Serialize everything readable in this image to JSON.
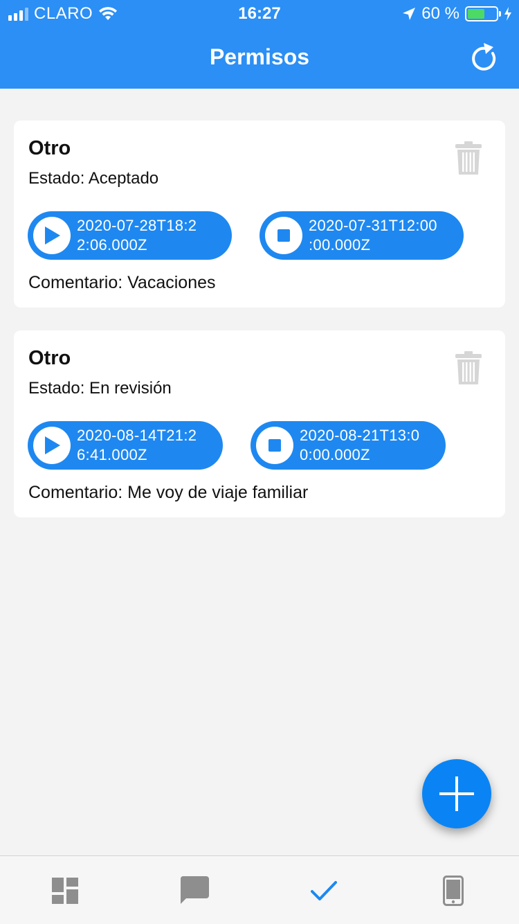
{
  "status_bar": {
    "carrier": "CLARO",
    "time": "16:27",
    "battery_label": "60 %",
    "battery_level": 0.6
  },
  "header": {
    "title": "Permisos",
    "refresh_icon": "refresh-icon"
  },
  "permits": [
    {
      "title": "Otro",
      "status": "Estado: Aceptado",
      "start": "2020-07-28T18:2\n2:06.000Z",
      "end": "2020-07-31T12:00\n:00.000Z",
      "comment": "Comentario: Vacaciones"
    },
    {
      "title": "Otro",
      "status": "Estado: En revisión",
      "start": "2020-08-14T21:2\n6:41.000Z",
      "end": "2020-08-21T13:0\n0:00.000Z",
      "comment": "Comentario: Me voy de viaje familiar"
    }
  ],
  "fab": {
    "icon": "plus-icon"
  },
  "tab_bar": {
    "tabs": [
      {
        "icon": "dashboard-icon",
        "active": false
      },
      {
        "icon": "chat-icon",
        "active": false
      },
      {
        "icon": "check-icon",
        "active": true
      },
      {
        "icon": "phone-icon",
        "active": false
      }
    ]
  },
  "colors": {
    "primary": "#2b8ff5",
    "pill": "#1e88f0",
    "fab": "#0a84f5",
    "tab_active": "#1e88f0",
    "tab_inactive": "#8e8e8e"
  }
}
